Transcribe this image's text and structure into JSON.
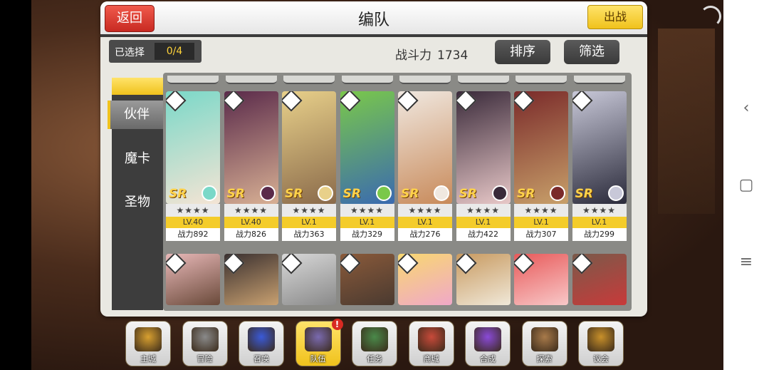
{
  "header": {
    "back_label": "返回",
    "title": "编队",
    "battle_label": "出战"
  },
  "selection": {
    "label": "已选择",
    "count": "0/4"
  },
  "power": {
    "label": "战斗力",
    "value": "1734"
  },
  "buttons": {
    "sort": "排序",
    "filter": "筛选"
  },
  "side_tabs": [
    {
      "label": "伙伴"
    },
    {
      "label": "魔卡"
    },
    {
      "label": "圣物"
    }
  ],
  "cards": [
    {
      "rarity": "SR",
      "stars": "★★★★",
      "level": "LV.40",
      "power": "战力892",
      "colors": [
        "#7ad8c8",
        "#f4e4d4"
      ]
    },
    {
      "rarity": "SR",
      "stars": "★★★★",
      "level": "LV.40",
      "power": "战力826",
      "colors": [
        "#5a2a4a",
        "#d8b094"
      ]
    },
    {
      "rarity": "SR",
      "stars": "★★★★",
      "level": "LV.1",
      "power": "战力363",
      "colors": [
        "#e8d08a",
        "#8a6a4a"
      ]
    },
    {
      "rarity": "SR",
      "stars": "★★★★",
      "level": "LV.1",
      "power": "战力329",
      "colors": [
        "#7ac84a",
        "#3a6ab0"
      ]
    },
    {
      "rarity": "SR",
      "stars": "★★★★",
      "level": "LV.1",
      "power": "战力276",
      "colors": [
        "#f0e8e0",
        "#c88a5a"
      ]
    },
    {
      "rarity": "SR",
      "stars": "★★★★",
      "level": "LV.1",
      "power": "战力422",
      "colors": [
        "#3a2a3a",
        "#e8c8c8"
      ]
    },
    {
      "rarity": "SR",
      "stars": "★★★★",
      "level": "LV.1",
      "power": "战力307",
      "colors": [
        "#7a2a2a",
        "#c8a06a"
      ]
    },
    {
      "rarity": "SR",
      "stars": "★★★★",
      "level": "LV.1",
      "power": "战力299",
      "colors": [
        "#c8c8d8",
        "#2a2a3a"
      ]
    }
  ],
  "cards_row2": [
    {
      "colors": [
        "#e8b8b8",
        "#6a4a3a"
      ]
    },
    {
      "colors": [
        "#3a3030",
        "#c8a070"
      ]
    },
    {
      "colors": [
        "#d8d8d8",
        "#8a8a8a"
      ]
    },
    {
      "colors": [
        "#8a5a3a",
        "#4a3a30"
      ]
    },
    {
      "colors": [
        "#f8d870",
        "#f0a8c8"
      ]
    },
    {
      "colors": [
        "#c89a60",
        "#f0e8d8"
      ]
    },
    {
      "colors": [
        "#e85a5a",
        "#f8c8c8"
      ]
    },
    {
      "colors": [
        "#7a5a4a",
        "#c83a3a"
      ]
    }
  ],
  "menu": [
    {
      "label": "主城",
      "icon": "castle-icon",
      "color": "#d8a030"
    },
    {
      "label": "冒险",
      "icon": "swords-icon",
      "color": "#8a8a8a"
    },
    {
      "label": "召唤",
      "icon": "summon-card-icon",
      "color": "#3a5ad8"
    },
    {
      "label": "队伍",
      "icon": "team-emblem-icon",
      "color": "#7a6ab0",
      "active": true,
      "alert": "!"
    },
    {
      "label": "任务",
      "icon": "quest-book-icon",
      "color": "#4a8a4a"
    },
    {
      "label": "商城",
      "icon": "shop-mushroom-icon",
      "color": "#c84a3a"
    },
    {
      "label": "合成",
      "icon": "crystal-icon",
      "color": "#8a4ad8"
    },
    {
      "label": "探索",
      "icon": "bow-icon",
      "color": "#a87a4a"
    },
    {
      "label": "议会",
      "icon": "council-icon",
      "color": "#c8902a"
    }
  ]
}
